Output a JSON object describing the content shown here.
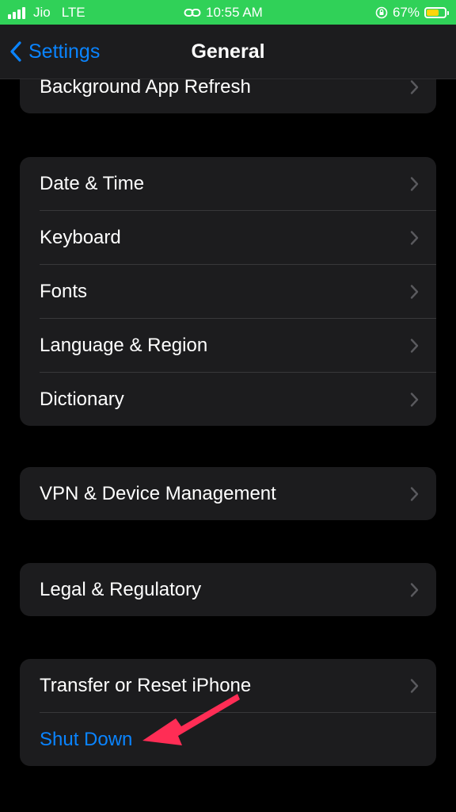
{
  "status_bar": {
    "carrier": "Jio",
    "network": "LTE",
    "time": "10:55 AM",
    "battery": "67%",
    "battery_level": 0.67,
    "colors": {
      "bar": "#30d158",
      "battery": "#ffd60a"
    },
    "icons": [
      "signal-icon",
      "hotspot-link-icon",
      "orientation-lock-icon",
      "battery-icon"
    ]
  },
  "nav": {
    "back_label": "Settings",
    "title": "General",
    "back_icon": "chevron-left-icon"
  },
  "groups": [
    {
      "items": [
        {
          "label": "Background App Refresh"
        }
      ]
    },
    {
      "items": [
        {
          "label": "Date & Time"
        },
        {
          "label": "Keyboard"
        },
        {
          "label": "Fonts"
        },
        {
          "label": "Language & Region"
        },
        {
          "label": "Dictionary"
        }
      ]
    },
    {
      "items": [
        {
          "label": "VPN & Device Management"
        }
      ]
    },
    {
      "items": [
        {
          "label": "Legal & Regulatory"
        }
      ]
    },
    {
      "items": [
        {
          "label": "Transfer or Reset iPhone"
        },
        {
          "label": "Shut Down"
        }
      ]
    }
  ],
  "colors": {
    "accent": "#0a84ff",
    "background": "#000000",
    "cell": "#1c1c1e",
    "annotation_arrow": "#ff2d55"
  }
}
